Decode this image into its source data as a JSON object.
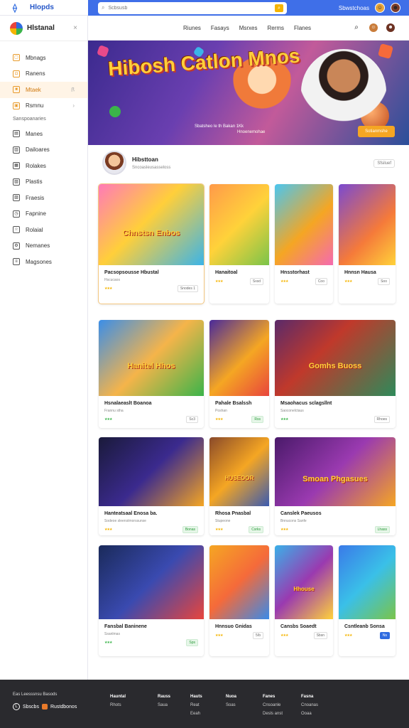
{
  "topbar": {
    "brand": "Hlopds",
    "search_placeholder": "Scbsusb",
    "search_button": "⌕",
    "user_label": "Sbwstchoas",
    "avatar1": "☺",
    "avatar2": "☻"
  },
  "sidebar": {
    "title": "Hlstanal",
    "close": "×",
    "items": [
      {
        "label": "Mbnags"
      },
      {
        "label": "Ranens"
      },
      {
        "label": "Mtaek"
      },
      {
        "label": "Rsmnu"
      }
    ],
    "section": "Sanspoanaries",
    "items2": [
      {
        "label": "Manes"
      },
      {
        "label": "Dailoares"
      },
      {
        "label": "Rolakes"
      },
      {
        "label": "Plastis"
      },
      {
        "label": "Fraesis"
      },
      {
        "label": "Fapnine"
      },
      {
        "label": "Rolaial"
      },
      {
        "label": "Nemanes"
      },
      {
        "label": "Magsones"
      }
    ]
  },
  "nav": {
    "links": [
      "Riunes",
      "Fasays",
      "Msrxes",
      "Rerms",
      "Flanes"
    ]
  },
  "hero": {
    "title": "Hibosh Catlon Mnos",
    "sub1": "Sbatsheo le th Bakan 1Kk",
    "sub2": "Hnoenemohae",
    "button": "Sotianmshe"
  },
  "profile": {
    "name": "Hibsttoan",
    "sub": "Sncoasleusasseloss",
    "tag": "Sfsiluef"
  },
  "cards": [
    {
      "title": "Pacsopsousse Hbustal",
      "sub": "Hscucaos",
      "tag": "Snodes 1",
      "thumb": "Chnstsn Enbos"
    },
    {
      "title": "Hanaitoal",
      "sub": "",
      "tag": "Sxsd",
      "thumb": ""
    },
    {
      "title": "Hnsstorhast",
      "sub": "",
      "tag": "Coo",
      "thumb": ""
    },
    {
      "title": "Hnnsn Hausa",
      "sub": "",
      "tag": "Soo",
      "thumb": ""
    },
    {
      "title": "Hsnalaeaslt Boanoa",
      "sub": "Frannu stha",
      "tag": "Sc3",
      "thumb": "Hanitel Hhos"
    },
    {
      "title": "Pahale Bsalssh",
      "sub": "Poshan",
      "tag": "Rss",
      "thumb": ""
    },
    {
      "title": "Msaohacus sclagsllnt",
      "sub": "Saoconelctaus",
      "tag": "Rhoes",
      "thumb": "Gomhs Buoss"
    },
    {
      "title": "Hanteatsaal Enosa ba.",
      "sub": "Sodeoe sleenstmorssunse",
      "tag": "Bonas",
      "thumb": ""
    },
    {
      "title": "Rhosa Pnasbal",
      "sub": "Stupeone",
      "tag": "Csrks",
      "thumb": "HUSEOOR"
    },
    {
      "title": "Canslek Paeusos",
      "sub": "Bnnucons Sanfe",
      "tag": "Lhass",
      "thumb": "Smoan Phgasues"
    },
    {
      "title": "Fansbal Baninene",
      "sub": "Ssanlmas",
      "tag": "Sps",
      "thumb": ""
    },
    {
      "title": "Hnnsuo Gnidas",
      "sub": "",
      "tag": "5/b",
      "thumb": ""
    },
    {
      "title": "Cansbs Soaedt",
      "sub": "",
      "tag": "Sbsn",
      "thumb": "Hhouse"
    },
    {
      "title": "Csntleanb Sonsa",
      "sub": "",
      "tag": "Ns",
      "thumb": ""
    }
  ],
  "footer": {
    "brand": "Eas Leesssnsu Basods",
    "logo_label": "Sbscbs",
    "logo_label2": "Rustdbonos",
    "cols": [
      {
        "head": "Hauntal",
        "l1": "Rhots",
        "l2": ""
      },
      {
        "head": "Rauss",
        "l1": "Saua",
        "l2": ""
      },
      {
        "head": "Hauts",
        "l1": "Reat",
        "l2": "Eeah"
      },
      {
        "head": "Nuoa",
        "l1": "Soas",
        "l2": ""
      },
      {
        "head": "Fanes",
        "l1": "Cnsoanle",
        "l2": "Desls anst"
      },
      {
        "head": "Fasna",
        "l1": "Cnoanas",
        "l2": "Ooaa"
      }
    ]
  }
}
